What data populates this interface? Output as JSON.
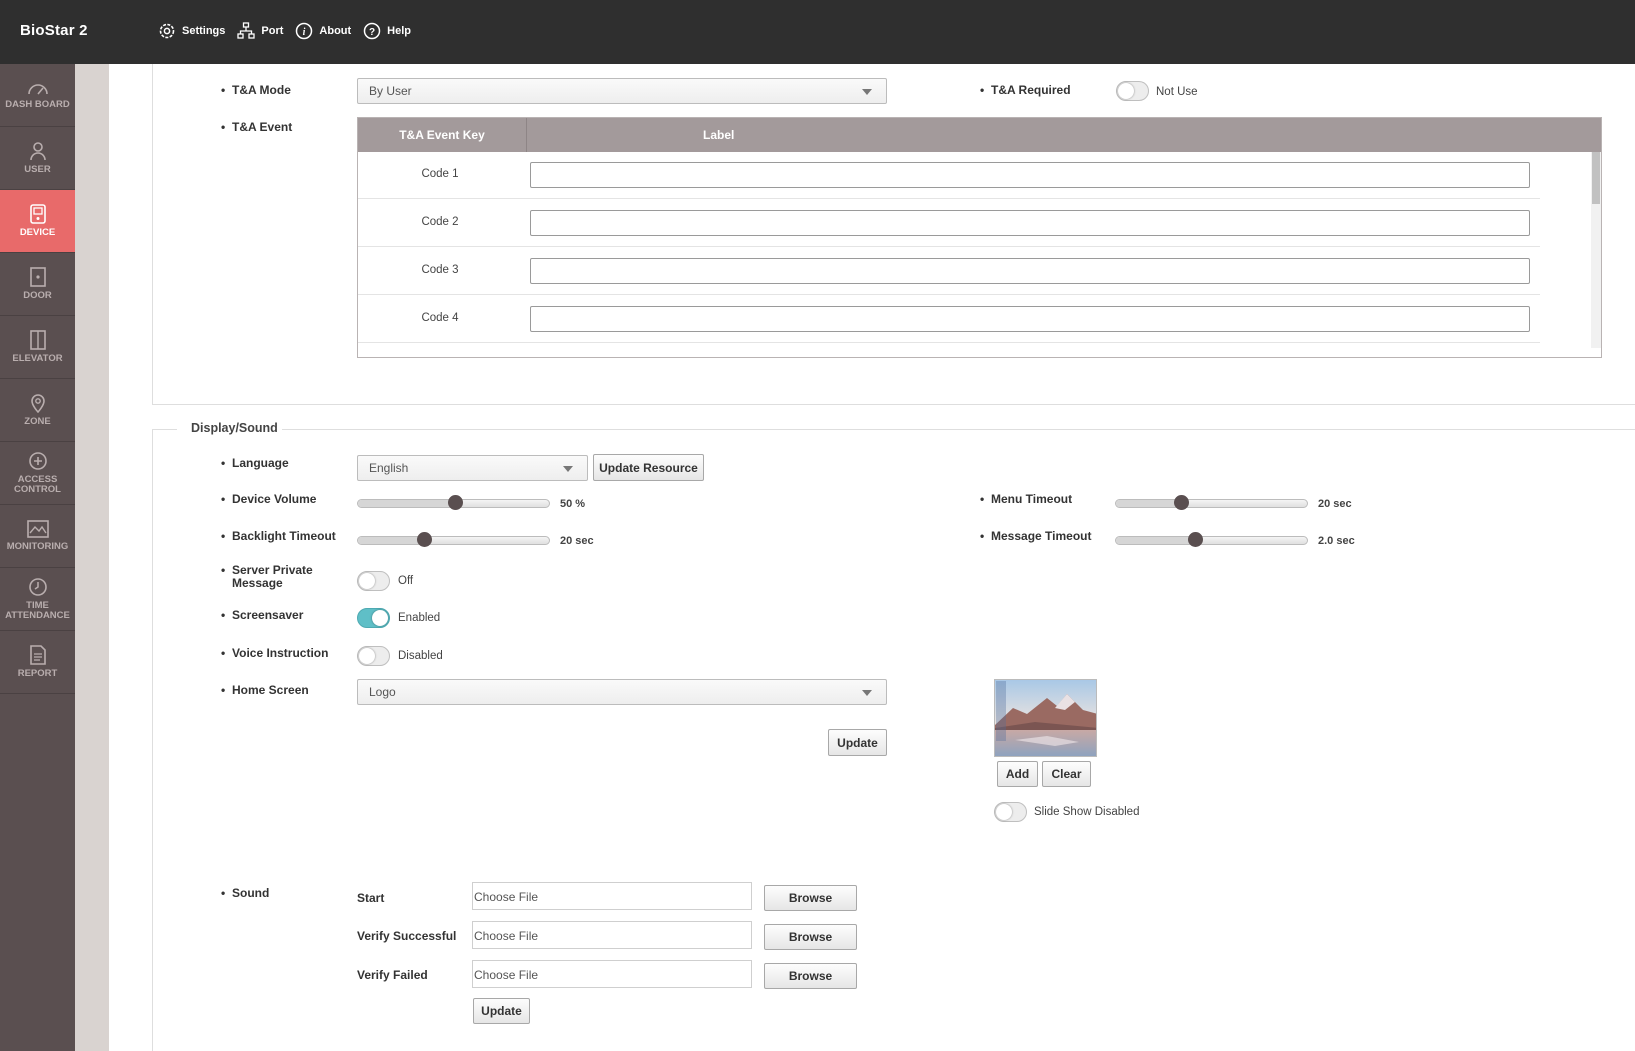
{
  "app": {
    "title": "BioStar 2"
  },
  "topnav": {
    "settings": "Settings",
    "port": "Port",
    "about": "About",
    "help": "Help"
  },
  "sidebar": {
    "items": [
      {
        "label": "DASH BOARD"
      },
      {
        "label": "USER"
      },
      {
        "label": "DEVICE"
      },
      {
        "label": "DOOR"
      },
      {
        "label": "ELEVATOR"
      },
      {
        "label": "ZONE"
      },
      {
        "label": "ACCESS CONTROL"
      },
      {
        "label": "MONITORING"
      },
      {
        "label": "TIME ATTENDANCE"
      },
      {
        "label": "REPORT"
      }
    ]
  },
  "ta": {
    "mode_label": "T&A Mode",
    "mode_value": "By User",
    "required_label": "T&A Required",
    "required_state": "Not Use",
    "event_label": "T&A Event",
    "table": {
      "col_key": "T&A Event Key",
      "col_label": "Label",
      "rows": [
        {
          "key": "Code 1",
          "value": ""
        },
        {
          "key": "Code 2",
          "value": ""
        },
        {
          "key": "Code 3",
          "value": ""
        },
        {
          "key": "Code 4",
          "value": ""
        }
      ]
    }
  },
  "display": {
    "section_title": "Display/Sound",
    "language_label": "Language",
    "language_value": "English",
    "update_resource": "Update Resource",
    "device_volume_label": "Device Volume",
    "device_volume_value": "50 %",
    "device_volume_level": 0.5,
    "menu_timeout_label": "Menu Timeout",
    "menu_timeout_value": "20 sec",
    "backlight_label": "Backlight Timeout",
    "backlight_value": "20 sec",
    "message_timeout_label": "Message Timeout",
    "message_timeout_value": "2.0 sec",
    "server_msg_label": "Server Private Message",
    "server_msg_state": "Off",
    "screensaver_label": "Screensaver",
    "screensaver_state": "Enabled",
    "voice_label": "Voice Instruction",
    "voice_state": "Disabled",
    "home_label": "Home Screen",
    "home_value": "Logo",
    "update": "Update",
    "add": "Add",
    "clear": "Clear",
    "slideshow_state": "Slide Show Disabled"
  },
  "sound": {
    "label": "Sound",
    "rows": [
      {
        "name": "Start",
        "file": "Choose File",
        "browse": "Browse"
      },
      {
        "name": "Verify Successful",
        "file": "Choose File",
        "browse": "Browse"
      },
      {
        "name": "Verify Failed",
        "file": "Choose File",
        "browse": "Browse"
      }
    ],
    "update": "Update"
  },
  "colors": {
    "topbar": "#2f2f2f",
    "sidebar": "#5a4f50",
    "active": "#e86a6a",
    "toggle_on": "#5fbfc7",
    "table_header": "#a39a9b"
  }
}
